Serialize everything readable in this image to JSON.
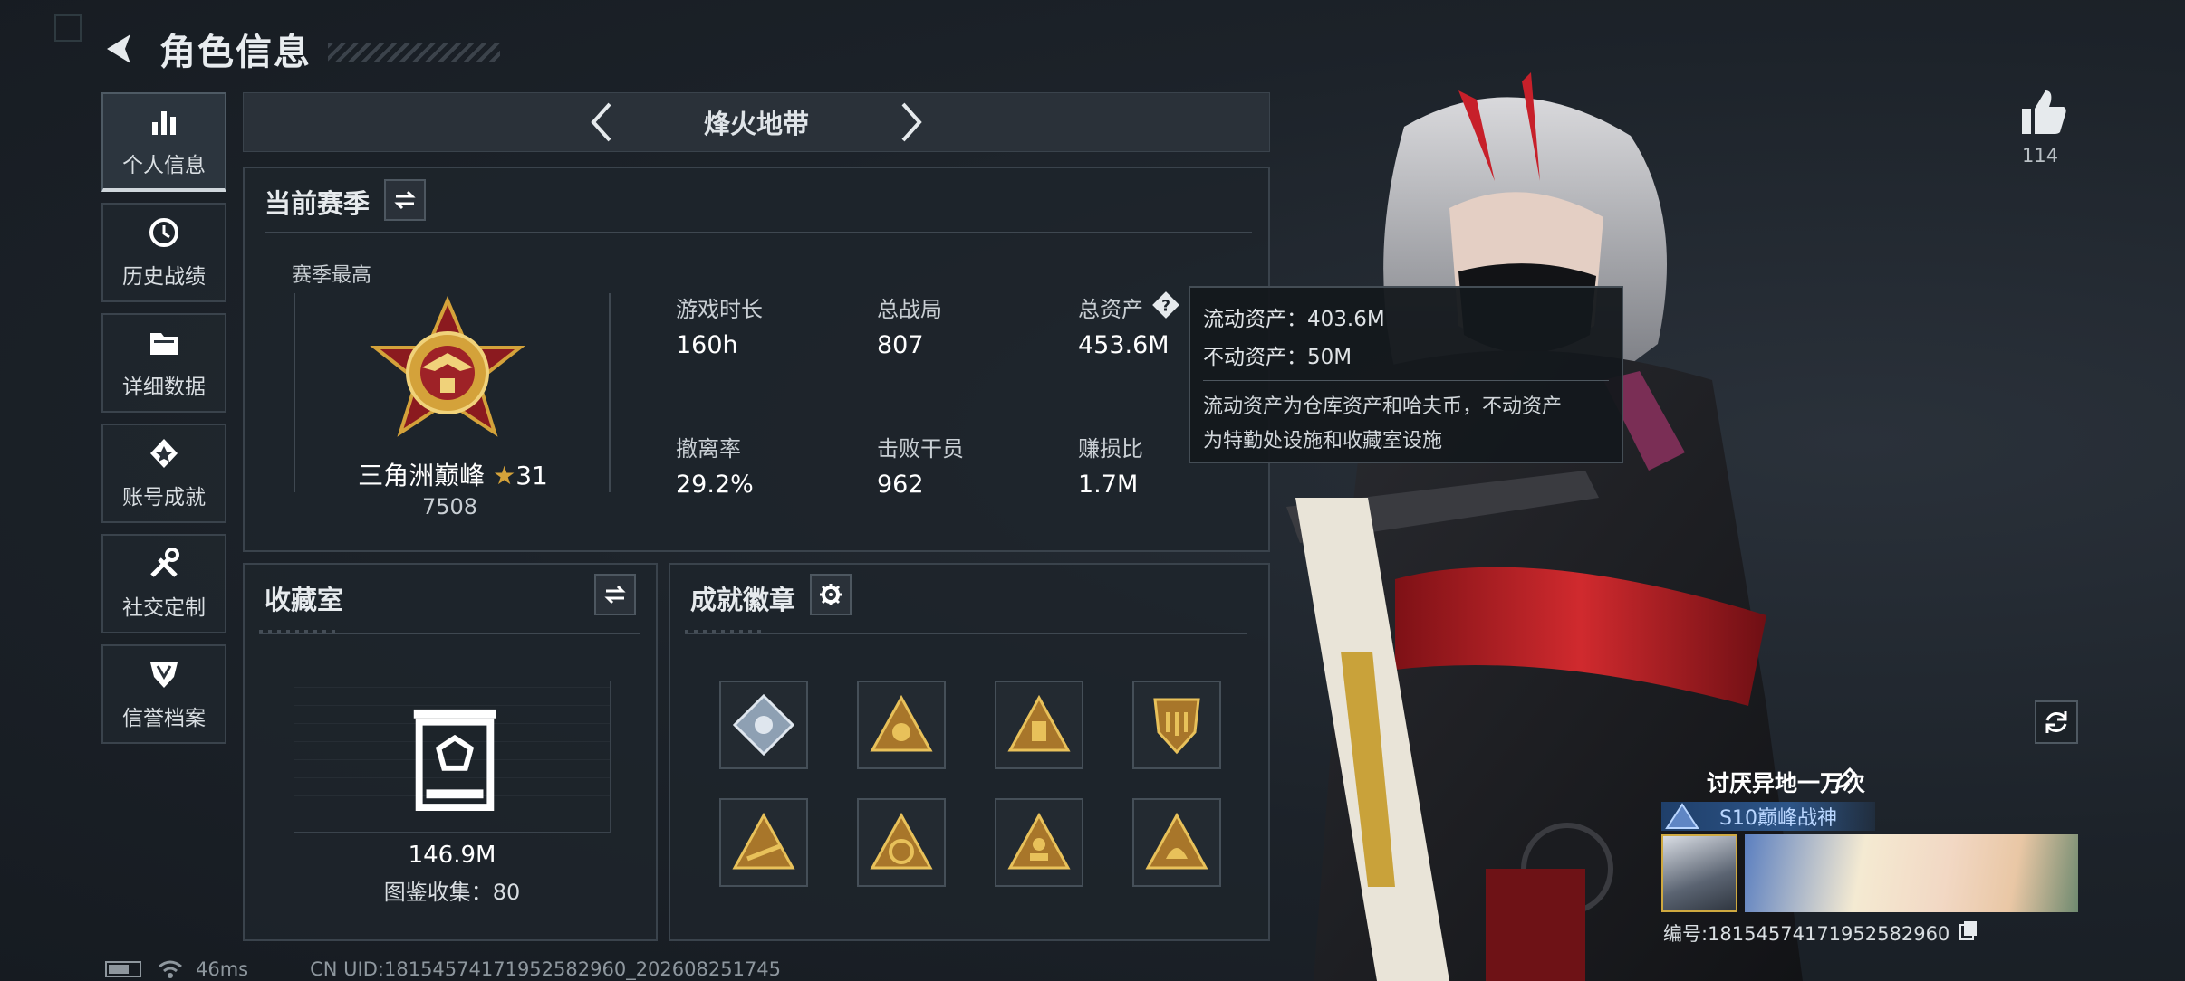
{
  "header": {
    "title": "角色信息",
    "back_icon": "back-arrow-icon"
  },
  "sidebar": {
    "items": [
      {
        "label": "个人信息",
        "icon": "bar-chart-icon",
        "active": true
      },
      {
        "label": "历史战绩",
        "icon": "history-clock-icon",
        "active": false
      },
      {
        "label": "详细数据",
        "icon": "folder-icon",
        "active": false
      },
      {
        "label": "账号成就",
        "icon": "achievement-icon",
        "active": false
      },
      {
        "label": "社交定制",
        "icon": "tools-icon",
        "active": false
      },
      {
        "label": "信誉档案",
        "icon": "shield-badge-icon",
        "active": false
      }
    ]
  },
  "mode_selector": {
    "current": "烽火地带"
  },
  "season": {
    "title": "当前赛季",
    "peak_label": "赛季最高",
    "rank_name": "三角洲巅峰",
    "rank_stars": "31",
    "rank_points": "7508",
    "stats": [
      {
        "label": "游戏时长",
        "value": "160h"
      },
      {
        "label": "总战局",
        "value": "807"
      },
      {
        "label": "总资产",
        "value": "453.6M"
      },
      {
        "label": "撤离率",
        "value": "29.2%"
      },
      {
        "label": "击败干员",
        "value": "962"
      },
      {
        "label": "赚损比",
        "value": "1.7M"
      }
    ]
  },
  "tooltip": {
    "line1": "流动资产：403.6M",
    "line2": "不动资产：50M",
    "note_line1": "流动资产为仓库资产和哈夫币，不动资产",
    "note_line2": "为特勤处设施和收藏室设施"
  },
  "collection": {
    "title": "收藏室",
    "value": "146.9M",
    "catalog": "图鉴收集：80"
  },
  "badges": {
    "title": "成就徽章",
    "items": [
      "badge-diamond-icon",
      "badge-triangle-icon",
      "badge-triangle-icon",
      "badge-shield-icon",
      "badge-triangle-icon",
      "badge-triangle-icon",
      "badge-triangle-icon",
      "badge-triangle-icon"
    ]
  },
  "likes": {
    "count": "114"
  },
  "player": {
    "name": "讨厌异地一万次",
    "title_badge": "S10巅峰战神",
    "id_text": "编号:1815457417195258296​0"
  },
  "status": {
    "ping": "46ms",
    "uid": "CN UID:1815457417195258296​0_202608251745"
  },
  "colors": {
    "accent_red": "#c7202a",
    "gold": "#d4a23a",
    "panel": "#1e242b"
  }
}
